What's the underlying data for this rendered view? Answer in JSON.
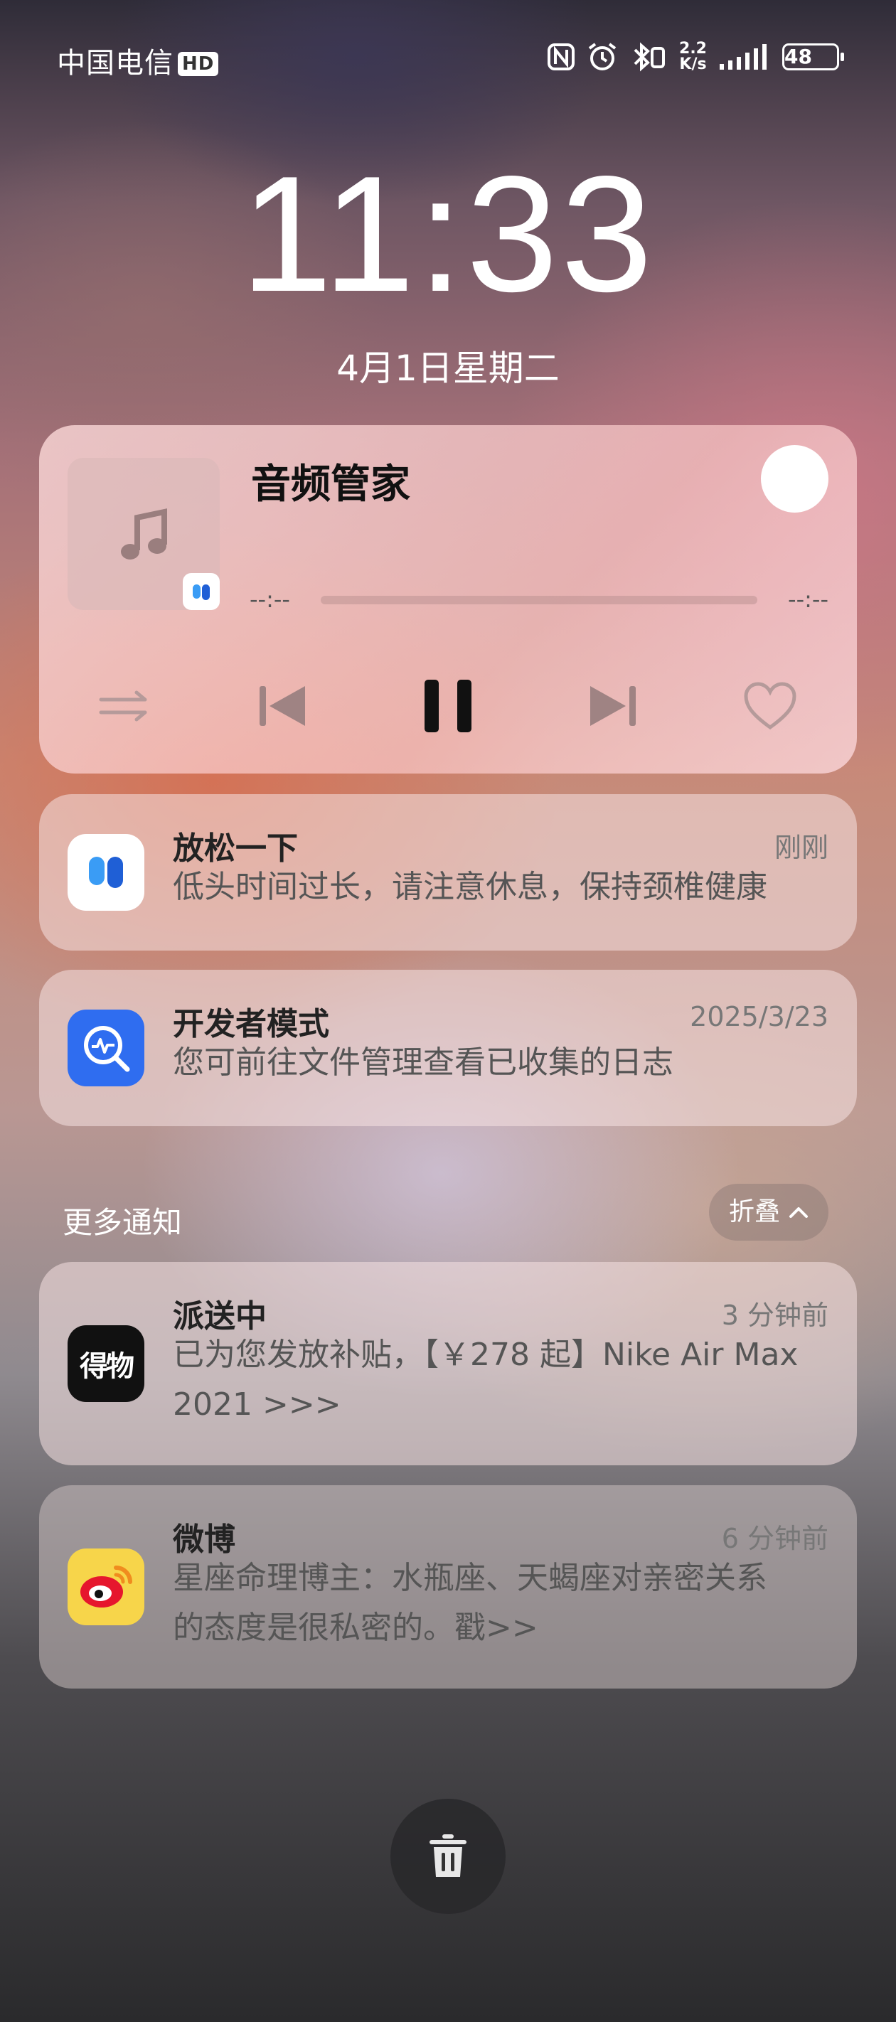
{
  "status_bar": {
    "carrier": "中国电信",
    "hd_badge": "HD",
    "net_speed_value": "2.2",
    "net_speed_unit": "K/s",
    "battery": "48",
    "icons": [
      "nfc-icon",
      "alarm-icon",
      "bluetooth-icon",
      "signal-icon",
      "battery-icon"
    ]
  },
  "lockscreen": {
    "time": "11:33",
    "date": "4月1日星期二"
  },
  "media_player": {
    "app_title": "音频管家",
    "current_time": "--:--",
    "total_time": "--:--",
    "progress": 0,
    "controls": [
      "shuffle-icon",
      "previous-icon",
      "pause-icon",
      "next-icon",
      "heart-icon"
    ]
  },
  "notifications": [
    {
      "app_icon": "audio-manager-icon",
      "title": "放松一下",
      "time": "刚刚",
      "body": "低头时间过长，请注意休息，保持颈椎健康"
    },
    {
      "app_icon": "developer-mode-icon",
      "title": "开发者模式",
      "time": "2025/3/23",
      "body": "您可前往文件管理查看已收集的日志"
    }
  ],
  "more_notifications": {
    "label": "更多通知",
    "fold_label": "折叠",
    "items": [
      {
        "app_icon": "dewu-icon",
        "icon_text": "得物",
        "title": "派送中",
        "time": "3 分钟前",
        "body_line1": "已为您发放补贴，【￥278 起】Nike Air Max",
        "body_line2": "2021 >>>"
      },
      {
        "app_icon": "weibo-icon",
        "title": "微博",
        "time": "6 分钟前",
        "body_line1": "星座命理博主：水瓶座、天蝎座对亲密关系",
        "body_line2": "的态度是很私密的。戳>>"
      }
    ]
  },
  "actions": {
    "clear_all": "trash-icon"
  },
  "colors": {
    "developer_icon_bg": "#2f6df0",
    "dewu_icon_bg": "#111111",
    "weibo_icon_bg": "#f7d54a"
  }
}
